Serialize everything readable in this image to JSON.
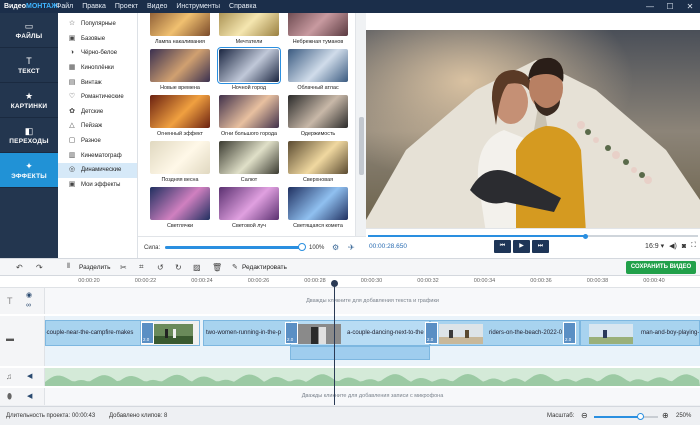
{
  "app": {
    "logo_a": "Видео",
    "logo_b": "МОНТАЖ"
  },
  "menu": [
    "Файл",
    "Правка",
    "Проект",
    "Видео",
    "Инструменты",
    "Справка"
  ],
  "window_controls": {
    "minimize": "—",
    "maximize": "☐",
    "close": "✕"
  },
  "nav": [
    {
      "label": "ФАЙЛЫ",
      "icon": "folder-icon",
      "glyph": "▭"
    },
    {
      "label": "ТЕКСТ",
      "icon": "text-icon",
      "glyph": "T"
    },
    {
      "label": "КАРТИНКИ",
      "icon": "star-icon",
      "glyph": "★"
    },
    {
      "label": "ПЕРЕХОДЫ",
      "icon": "transitions-icon",
      "glyph": "◧"
    },
    {
      "label": "ЭФФЕКТЫ",
      "icon": "effects-icon",
      "glyph": "✦",
      "active": true
    }
  ],
  "categories": [
    {
      "label": "Популярные",
      "icon": "star-outline-icon",
      "glyph": "☆"
    },
    {
      "label": "Базовые",
      "icon": "basic-icon",
      "glyph": "▣"
    },
    {
      "label": "Чёрно-белое",
      "icon": "bw-icon",
      "glyph": "◑"
    },
    {
      "label": "Киноплёнки",
      "icon": "film-icon",
      "glyph": "▦"
    },
    {
      "label": "Винтаж",
      "icon": "vintage-icon",
      "glyph": "▤"
    },
    {
      "label": "Романтические",
      "icon": "heart-icon",
      "glyph": "♡"
    },
    {
      "label": "Детские",
      "icon": "kids-icon",
      "glyph": "✿"
    },
    {
      "label": "Пейзаж",
      "icon": "landscape-icon",
      "glyph": "△"
    },
    {
      "label": "Разное",
      "icon": "misc-icon",
      "glyph": "▢"
    },
    {
      "label": "Кинематограф",
      "icon": "cinema-icon",
      "glyph": "▥"
    },
    {
      "label": "Динамические",
      "icon": "dynamic-icon",
      "glyph": "◎",
      "active": true
    },
    {
      "label": "Мои эффекты",
      "icon": "my-effects-icon",
      "glyph": "▣"
    }
  ],
  "effects": [
    {
      "label": "Лампа накаливания",
      "c1": "#7a4a2a",
      "c2": "#f0c070"
    },
    {
      "label": "Мечтатели",
      "c1": "#9a8040",
      "c2": "#f5e6b0"
    },
    {
      "label": "Небрежная туманов",
      "c1": "#5a3a40",
      "c2": "#c89aa0"
    },
    {
      "label": "Новые времена",
      "c1": "#3a3050",
      "c2": "#d0a070"
    },
    {
      "label": "Ночной город",
      "c1": "#1a2540",
      "c2": "#c0c8d8",
      "selected": true
    },
    {
      "label": "Облачный атлас",
      "c1": "#3a5a80",
      "c2": "#d0dcea"
    },
    {
      "label": "Огненный эффект",
      "c1": "#6a2010",
      "c2": "#f0a040"
    },
    {
      "label": "Огни большого города",
      "c1": "#40304a",
      "c2": "#e8c0a0"
    },
    {
      "label": "Одержимость",
      "c1": "#2a2a2a",
      "c2": "#c8b8a8"
    },
    {
      "label": "Поздняя весна",
      "c1": "#e0d8c0",
      "c2": "#fff8e8"
    },
    {
      "label": "Салют",
      "c1": "#3a3a30",
      "c2": "#e0e0c8"
    },
    {
      "label": "Сверхновая",
      "c1": "#5a4a30",
      "c2": "#f0d8a0"
    },
    {
      "label": "Светлячки",
      "c1": "#203060",
      "c2": "#d080c0"
    },
    {
      "label": "Световой луч",
      "c1": "#5a3070",
      "c2": "#e0a0e0"
    },
    {
      "label": "Светящаяся комета",
      "c1": "#203060",
      "c2": "#90c0f0"
    }
  ],
  "strength": {
    "label": "Сила:",
    "value": "100%",
    "fraction": 1.0
  },
  "player": {
    "time": "00:00:28.650",
    "progress": 0.66,
    "aspect": "16:9 ▾",
    "buttons": [
      "⏮",
      "▶",
      "⏭"
    ]
  },
  "toolbar": {
    "split_label": "Разделить",
    "edit_label": "Редактировать",
    "save_label": "СОХРАНИТЬ ВИДЕО"
  },
  "ruler": [
    "00:00:20",
    "00:00:22",
    "00:00:24",
    "00:00:26",
    "00:00:28",
    "00:00:30",
    "00:00:32",
    "00:00:34",
    "00:00:36",
    "00:00:38",
    "00:00:40"
  ],
  "timeline": {
    "text_hint": "Дважды кликните для добавления текста и графики",
    "mic_hint": "Дважды кликните для добавления записи с микрофона",
    "clips": [
      "ty-couple-near-the-campfire-makes",
      "two-women-running-in-the-p",
      "a-couple-dancing-next-to-the",
      "riders-on-the-beach-2022-0",
      "man-and-boy-playing-soc"
    ],
    "trans_time": "2.0"
  },
  "status": {
    "duration": "Длительность проекта: 00:00:43",
    "clips_added": "Добавлено клипов: 8",
    "zoom_label": "Масштаб:",
    "zoom_value": "250%",
    "zoom_fraction": 0.72
  }
}
